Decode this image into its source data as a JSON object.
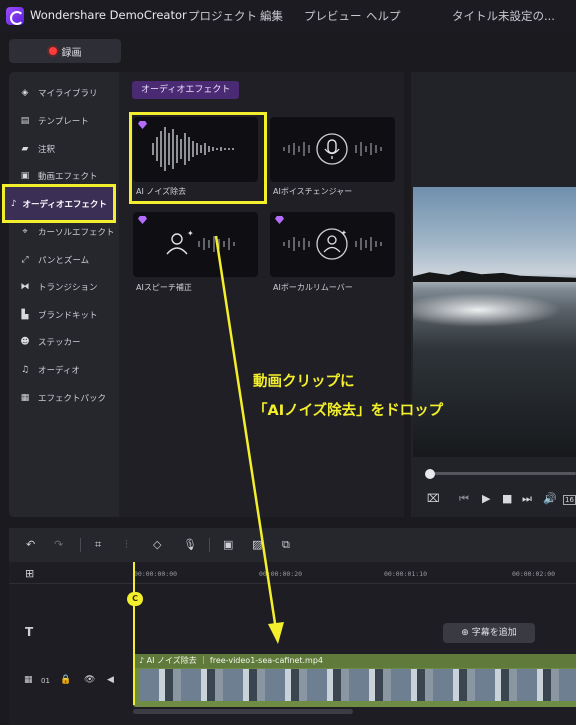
{
  "titlebar": {
    "app_name": "Wondershare DemoCreator",
    "menus": [
      "プロジェクト",
      "編集",
      "プレビュー",
      "ヘルプ"
    ],
    "document_title": "タイトル未設定の..."
  },
  "record_button": "録画",
  "sidebar": {
    "items": [
      {
        "icon": "layers-icon",
        "label": "マイライブラリ"
      },
      {
        "icon": "template-icon",
        "label": "テンプレート"
      },
      {
        "icon": "annotation-icon",
        "label": "注釈"
      },
      {
        "icon": "video-effect-icon",
        "label": "動画エフェクト"
      },
      {
        "icon": "music-note-icon",
        "label": "オーディオエフェクト",
        "active": true
      },
      {
        "icon": "cursor-icon",
        "label": "カーソルエフェクト"
      },
      {
        "icon": "pan-zoom-icon",
        "label": "パンとズーム"
      },
      {
        "icon": "transition-icon",
        "label": "トランジション"
      },
      {
        "icon": "brand-kit-icon",
        "label": "ブランドキット"
      },
      {
        "icon": "sticker-icon",
        "label": "ステッカー"
      },
      {
        "icon": "audio-icon",
        "label": "オーディオ"
      },
      {
        "icon": "effect-pack-icon",
        "label": "エフェクトパック"
      }
    ]
  },
  "panel": {
    "category_tag": "オーディオエフェクト",
    "cards": [
      {
        "label": "AI ノイズ除去",
        "thumb": "waveform-icon",
        "premium": true
      },
      {
        "label": "AIボイスチェンジャー",
        "thumb": "microphone-icon",
        "premium": false
      },
      {
        "label": "AIスピーチ補正",
        "thumb": "person-voice-icon",
        "premium": true
      },
      {
        "label": "AIボーカルリムーバー",
        "thumb": "person-remove-icon",
        "premium": true
      }
    ]
  },
  "annotation": {
    "line1": "動画クリップに",
    "line2": "「AIノイズ除去」をドロップ",
    "color": "#f3ef2c"
  },
  "timeline": {
    "ruler_ticks": [
      "00:00:00:00",
      "00:00:00:20",
      "00:00:01:10",
      "00:00:02:00"
    ],
    "playhead_label": "C",
    "add_subtitle": "字幕を追加",
    "track_label": "01",
    "clip": {
      "effect": "AI ノイズ除去",
      "filename": "free-video1-sea-cafinet.mp4"
    }
  },
  "colors": {
    "highlight": "#f3ef2c",
    "accent_purple": "#9b4dff",
    "clip_green": "#6f8c45"
  }
}
